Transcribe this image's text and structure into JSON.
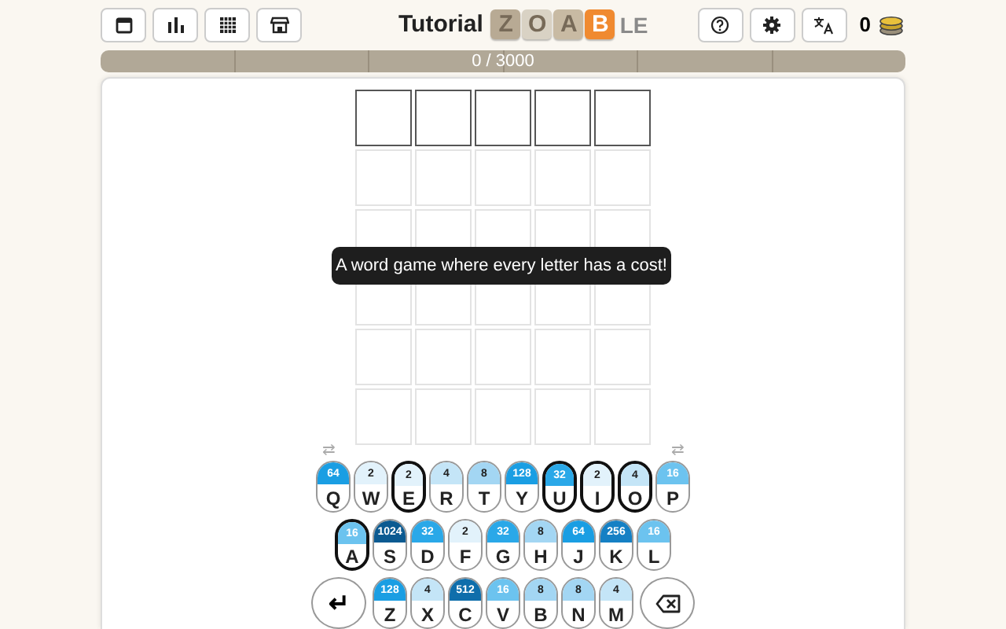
{
  "header": {
    "left_buttons": [
      {
        "kind": "calendar"
      },
      {
        "kind": "stats"
      },
      {
        "kind": "grid"
      },
      {
        "kind": "shop"
      }
    ],
    "title": "Tutorial",
    "logo": [
      {
        "letter": "Z",
        "color": "#b8aa94"
      },
      {
        "letter": "O",
        "color": "#d9d2c4"
      },
      {
        "letter": "A",
        "color": "#c8baa3"
      },
      {
        "letter": "B",
        "color": "#f08a30"
      }
    ],
    "logo_suffix": "LE",
    "right_buttons": [
      {
        "kind": "help"
      },
      {
        "kind": "settings"
      },
      {
        "kind": "translate"
      }
    ],
    "coins": "0"
  },
  "progress": {
    "text": "0 / 3000"
  },
  "board": {
    "rows": [
      {
        "active": true
      },
      {
        "active": false
      },
      {
        "active": false
      },
      {
        "active": false
      },
      {
        "active": false
      },
      {
        "active": false
      }
    ]
  },
  "tooltip": "A word game where every letter has a cost!",
  "swap_left": "⇄",
  "swap_right": "⇄",
  "keyboard": {
    "rows": [
      [
        {
          "letter": "Q",
          "cost": "64",
          "color": "#1a9ee3",
          "highlighted": false
        },
        {
          "letter": "W",
          "cost": "2",
          "color": "#e2f2fb",
          "highlighted": false
        },
        {
          "letter": "E",
          "cost": "2",
          "color": "#e2f2fb",
          "highlighted": true
        },
        {
          "letter": "R",
          "cost": "4",
          "color": "#c4e5f7",
          "highlighted": false
        },
        {
          "letter": "T",
          "cost": "8",
          "color": "#a3d6f3",
          "highlighted": false
        },
        {
          "letter": "Y",
          "cost": "128",
          "color": "#1a9ee3",
          "highlighted": false
        },
        {
          "letter": "U",
          "cost": "32",
          "color": "#2aa8e8",
          "highlighted": true
        },
        {
          "letter": "I",
          "cost": "2",
          "color": "#e2f2fb",
          "highlighted": true
        },
        {
          "letter": "O",
          "cost": "4",
          "color": "#c4e5f7",
          "highlighted": true
        },
        {
          "letter": "P",
          "cost": "16",
          "color": "#6cc3ef",
          "highlighted": false
        }
      ],
      [
        {
          "letter": "A",
          "cost": "16",
          "color": "#6cc3ef",
          "highlighted": true
        },
        {
          "letter": "S",
          "cost": "1024",
          "color": "#0b5a91",
          "highlighted": false
        },
        {
          "letter": "D",
          "cost": "32",
          "color": "#2aa8e8",
          "highlighted": false
        },
        {
          "letter": "F",
          "cost": "2",
          "color": "#e2f2fb",
          "highlighted": false
        },
        {
          "letter": "G",
          "cost": "32",
          "color": "#2aa8e8",
          "highlighted": false
        },
        {
          "letter": "H",
          "cost": "8",
          "color": "#a3d6f3",
          "highlighted": false
        },
        {
          "letter": "J",
          "cost": "64",
          "color": "#1a9ee3",
          "highlighted": false
        },
        {
          "letter": "K",
          "cost": "256",
          "color": "#1580c4",
          "highlighted": false
        },
        {
          "letter": "L",
          "cost": "16",
          "color": "#6cc3ef",
          "highlighted": false
        }
      ],
      [
        {
          "letter": "Z",
          "cost": "128",
          "color": "#1a9ee3",
          "highlighted": false
        },
        {
          "letter": "X",
          "cost": "4",
          "color": "#c4e5f7",
          "highlighted": false
        },
        {
          "letter": "C",
          "cost": "512",
          "color": "#0f6eab",
          "highlighted": false
        },
        {
          "letter": "V",
          "cost": "16",
          "color": "#6cc3ef",
          "highlighted": false
        },
        {
          "letter": "B",
          "cost": "8",
          "color": "#a3d6f3",
          "highlighted": false
        },
        {
          "letter": "N",
          "cost": "8",
          "color": "#a3d6f3",
          "highlighted": false
        },
        {
          "letter": "M",
          "cost": "4",
          "color": "#c4e5f7",
          "highlighted": false
        }
      ]
    ],
    "enter": "↵"
  }
}
